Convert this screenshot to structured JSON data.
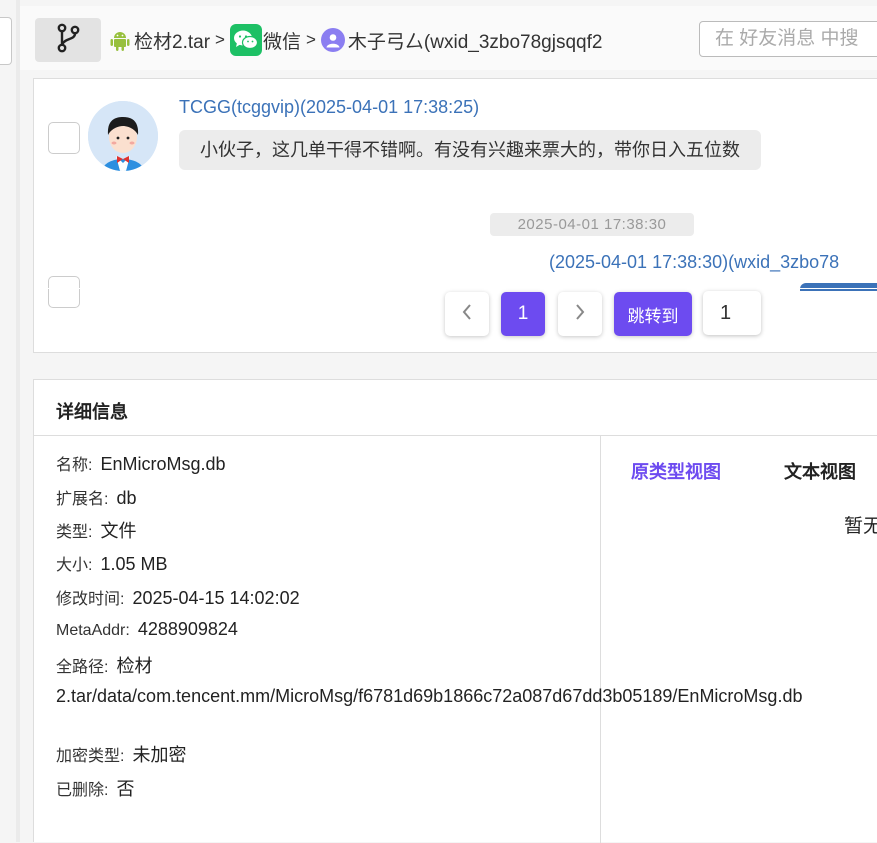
{
  "breadcrumb": {
    "items": [
      "检材2.tar",
      "微信",
      "木子弓厶(wxid_3zbo78gjsqqf2"
    ],
    "separator": ">"
  },
  "search": {
    "placeholder": "在 好友消息 中搜"
  },
  "messages": [
    {
      "sender": "TCGG(tcggvip)(2025-04-01 17:38:25)",
      "text": "小伙子，这几单干得不错啊。有没有兴趣来票大的，带你日入五位数"
    }
  ],
  "time_divider": "2025-04-01 17:38:30",
  "reply_sender": "(2025-04-01 17:38:30)(wxid_3zbo78",
  "pagination": {
    "current": "1",
    "jump_label": "跳转到",
    "jump_value": "1"
  },
  "detail": {
    "title": "详细信息",
    "fields": [
      {
        "label": "名称:",
        "value": "EnMicroMsg.db"
      },
      {
        "label": "扩展名:",
        "value": "db"
      },
      {
        "label": "类型:",
        "value": "文件"
      },
      {
        "label": "大小:",
        "value": "1.05 MB"
      },
      {
        "label": "修改时间:",
        "value": "2025-04-15 14:02:02"
      },
      {
        "label": "MetaAddr:",
        "value": "4288909824"
      }
    ],
    "fullpath": {
      "label": "全路径:",
      "value": "检材 2.tar/data/com.tencent.mm/MicroMsg/f6781d69b1866c72a087d67dd3b05189/EnMicroMsg.db"
    },
    "encryption": {
      "label": "加密类型:",
      "value": "未加密"
    },
    "deleted": {
      "label": "已删除:",
      "value": "否"
    },
    "tabs": [
      "原类型视图",
      "文本视图"
    ],
    "empty_text": "暂无"
  },
  "colors": {
    "accent": "#6d4bf0",
    "link": "#3b72b8",
    "wechat": "#1dc065",
    "android": "#97c03d"
  }
}
